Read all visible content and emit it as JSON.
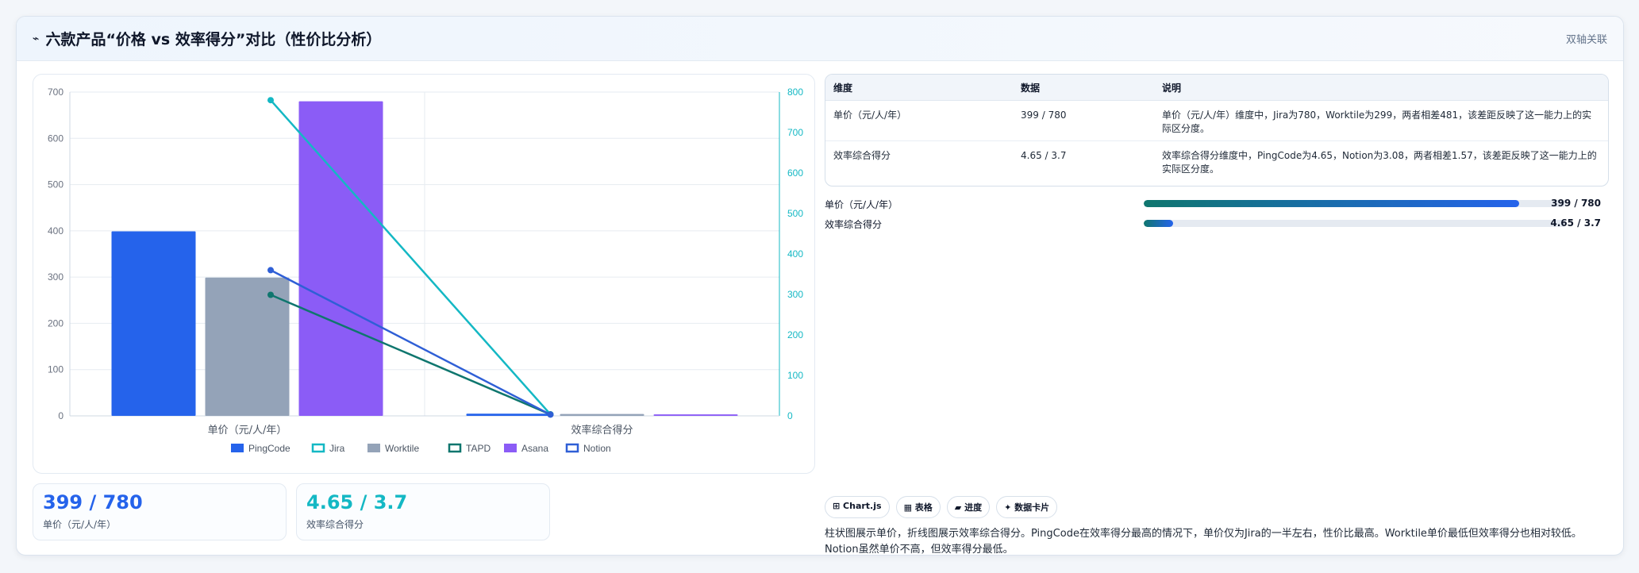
{
  "header": {
    "icon": "⌁",
    "title": "六款产品“价格 vs 效率得分”对比（性价比分析）",
    "badge": "双轴关联"
  },
  "chart_data": {
    "type": "bar",
    "categories": [
      "单价（元/人/年）",
      "效率综合得分"
    ],
    "left_axis": {
      "ylim": [
        0,
        700
      ],
      "ticks": [
        0,
        100,
        200,
        300,
        400,
        500,
        600,
        700
      ]
    },
    "right_axis": {
      "ylim": [
        0,
        800
      ],
      "ticks": [
        0,
        100,
        200,
        300,
        400,
        500,
        600,
        700,
        800
      ]
    },
    "bar_series": [
      {
        "name": "PingCode",
        "color": "#2563eb",
        "values": [
          399,
          4.65
        ]
      },
      {
        "name": "Worktile",
        "color": "#94a3b8",
        "values": [
          299,
          4.1
        ]
      },
      {
        "name": "Asana",
        "color": "#8b5cf6",
        "values": [
          680,
          3.3
        ]
      }
    ],
    "line_series": [
      {
        "name": "Jira",
        "color": "#14b8c4",
        "values": [
          780,
          3.7
        ]
      },
      {
        "name": "TAPD",
        "color": "#0f766e",
        "values": [
          299,
          3.6
        ]
      },
      {
        "name": "Notion",
        "color": "#2f5fd6",
        "values": [
          360,
          3.08
        ]
      }
    ],
    "legend": {
      "position": "bottom",
      "items": [
        {
          "name": "PingCode",
          "color": "#2563eb",
          "style": "fill"
        },
        {
          "name": "Jira",
          "color": "#14b8c4",
          "style": "outline"
        },
        {
          "name": "Worktile",
          "color": "#94a3b8",
          "style": "fill"
        },
        {
          "name": "TAPD",
          "color": "#0f766e",
          "style": "outline"
        },
        {
          "name": "Asana",
          "color": "#8b5cf6",
          "style": "fill"
        },
        {
          "name": "Notion",
          "color": "#2f5fd6",
          "style": "outline"
        }
      ]
    },
    "grid": true
  },
  "kpis": [
    {
      "value": "399 / 780",
      "label": "单价（元/人/年）",
      "color": "#2563eb"
    },
    {
      "value": "4.65 / 3.7",
      "label": "效率综合得分",
      "color": "#14b8c4"
    }
  ],
  "table": {
    "headers": [
      "维度",
      "数据",
      "说明"
    ],
    "rows": [
      [
        "单价（元/人/年）",
        "399 / 780",
        "单价（元/人/年）维度中，Jira为780，Worktile为299，两者相差481，该差距反映了这一能力上的实际区分度。"
      ],
      [
        "效率综合得分",
        "4.65 / 3.7",
        "效率综合得分维度中，PingCode为4.65，Notion为3.08，两者相差1.57，该差距反映了这一能力上的实际区分度。"
      ]
    ]
  },
  "progress": [
    {
      "label": "单价（元/人/年）",
      "value": "399 / 780",
      "fraction": 0.89
    },
    {
      "label": "效率综合得分",
      "value": "4.65 / 3.7",
      "fraction": 0.07
    }
  ],
  "tags": [
    "⊞ Chart.js",
    "▦ 表格",
    "▰ 进度",
    "✦ 数据卡片"
  ],
  "note": "柱状图展示单价，折线图展示效率综合得分。PingCode在效率得分最高的情况下，单价仅为Jira的一半左右，性价比最高。Worktile单价最低但效率得分也相对较低。Notion虽然单价不高，但效率得分最低。"
}
